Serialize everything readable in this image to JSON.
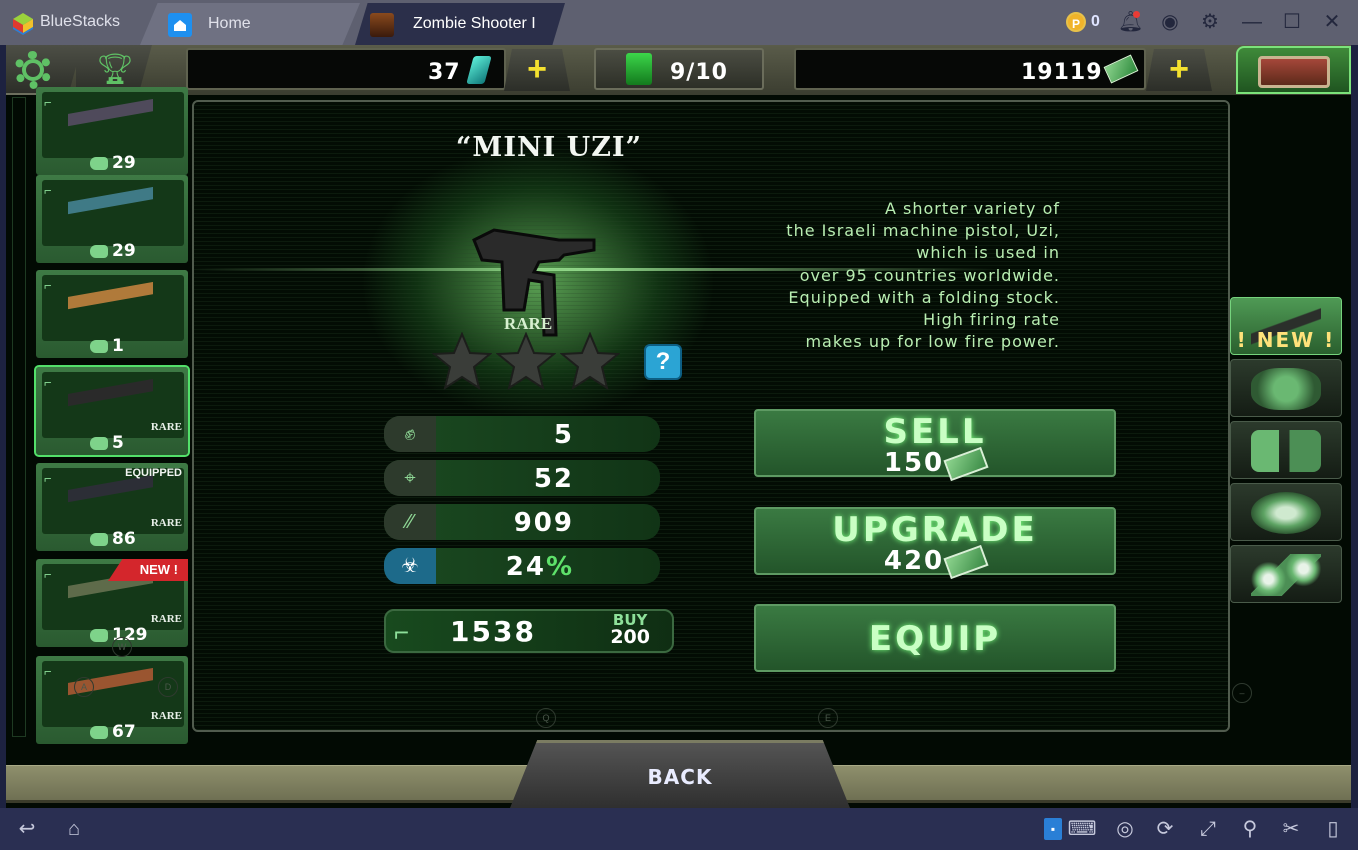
{
  "window": {
    "app_name": "BlueStacks",
    "tabs": [
      {
        "label": "Home",
        "icon": "home-icon"
      },
      {
        "label": "Zombie Shooter I",
        "icon": "game-thumbnail-icon"
      }
    ],
    "coins": "0",
    "controls": [
      "bell-icon",
      "account-icon",
      "settings-icon",
      "minimize-icon",
      "maximize-icon",
      "close-icon"
    ]
  },
  "hud": {
    "gems": "37",
    "fuel": "9/10",
    "cash": "19119",
    "settings_icon": "gear-icon",
    "achievements_icon": "trophy-icon",
    "chest_icon": "treasure-chest-icon"
  },
  "weapons": [
    {
      "type": "pistol-icon",
      "power": "29",
      "rarity": "",
      "tag": ""
    },
    {
      "type": "pistol-icon",
      "power": "29",
      "rarity": "",
      "tag": ""
    },
    {
      "type": "pistol-icon",
      "power": "1",
      "rarity": "",
      "tag": ""
    },
    {
      "type": "rifle-icon",
      "power": "5",
      "rarity": "RARE",
      "tag": "",
      "selected": true
    },
    {
      "type": "shotgun-icon",
      "power": "86",
      "rarity": "RARE",
      "tag": "EQUIPPED"
    },
    {
      "type": "launcher-icon",
      "power": "129",
      "rarity": "RARE",
      "tag": "NEW !"
    },
    {
      "type": "launcher-icon",
      "power": "67",
      "rarity": "RARE",
      "tag": ""
    }
  ],
  "detail": {
    "name": "“MINI UZI”",
    "rarity": "RARE",
    "stars_filled": 0,
    "stars_total": 3,
    "help": "?",
    "description": "A shorter variety of\nthe Israeli machine pistol, Uzi,\nwhich is used in\nover 95 countries worldwide.\nEquipped with a folding stock.\nHigh firing rate\nmakes up for low fire power.",
    "stats": [
      {
        "icon": "fist-icon",
        "value": "5"
      },
      {
        "icon": "crosshair-icon",
        "value": "52"
      },
      {
        "icon": "bullets-icon",
        "value": "909"
      },
      {
        "icon": "biohazard-icon",
        "value": "24",
        "suffix": "%"
      }
    ],
    "ammo": {
      "count": "1538",
      "buy_label": "BUY",
      "buy_price": "200"
    }
  },
  "actions": {
    "sell_label": "SELL",
    "sell_price": "150",
    "upgrade_label": "UPGRADE",
    "upgrade_price": "420",
    "equip_label": "EQUIP"
  },
  "categories": [
    {
      "name": "weapons",
      "badge": "! NEW !"
    },
    {
      "name": "armor"
    },
    {
      "name": "grenades"
    },
    {
      "name": "mines"
    },
    {
      "name": "drones"
    }
  ],
  "key_hints": [
    "W",
    "A",
    "D",
    "Q",
    "E",
    "–"
  ],
  "back_label": "BACK",
  "bottom_bar": [
    "back-icon",
    "home-icon",
    "keyboard-icon",
    "eye-icon",
    "rotate-icon",
    "fullscreen-icon",
    "location-icon",
    "scissors-icon",
    "shake-icon"
  ]
}
